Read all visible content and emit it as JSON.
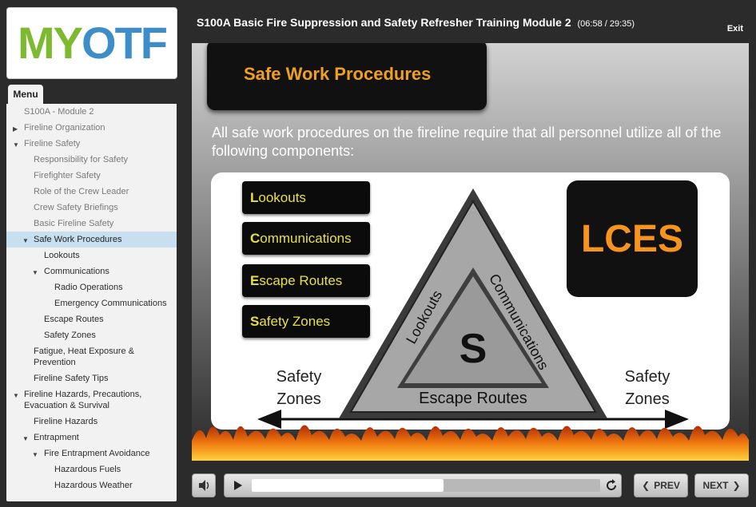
{
  "logo": {
    "text_m": "M",
    "text_y": "Y",
    "text_otf": "OTF"
  },
  "course": {
    "title": "S100A Basic Fire Suppression and Safety Refresher Training Module 2",
    "time": "(06:58 / 29:35)"
  },
  "header": {
    "exit_label": "Exit"
  },
  "menu": {
    "tab_label": "Menu",
    "items": [
      {
        "label": "S100A - Module 2",
        "level": 0,
        "arrow": ""
      },
      {
        "label": "Fireline Organization",
        "level": 0,
        "arrow": "right"
      },
      {
        "label": "Fireline Safety",
        "level": 0,
        "arrow": "down"
      },
      {
        "label": "Responsibility for Safety",
        "level": 1,
        "arrow": ""
      },
      {
        "label": "Firefighter Safety",
        "level": 1,
        "arrow": ""
      },
      {
        "label": "Role of the Crew Leader",
        "level": 1,
        "arrow": ""
      },
      {
        "label": "Crew Safety Briefings",
        "level": 1,
        "arrow": ""
      },
      {
        "label": "Basic Fireline Safety",
        "level": 1,
        "arrow": ""
      },
      {
        "label": "Safe Work Procedures",
        "level": 1,
        "arrow": "down",
        "active": true
      },
      {
        "label": "Lookouts",
        "level": 2,
        "arrow": "",
        "dark": true
      },
      {
        "label": "Communications",
        "level": 2,
        "arrow": "down",
        "dark": true
      },
      {
        "label": "Radio Operations",
        "level": 3,
        "arrow": "",
        "dark": true
      },
      {
        "label": "Emergency Communications",
        "level": 3,
        "arrow": "",
        "dark": true
      },
      {
        "label": "Escape Routes",
        "level": 2,
        "arrow": "",
        "dark": true
      },
      {
        "label": "Safety Zones",
        "level": 2,
        "arrow": "",
        "dark": true
      },
      {
        "label": "Fatigue, Heat Exposure & Prevention",
        "level": 1,
        "arrow": "",
        "dark": true
      },
      {
        "label": "Fireline Safety Tips",
        "level": 1,
        "arrow": "",
        "dark": true
      },
      {
        "label": "Fireline Hazards, Precautions, Evacuation & Survival",
        "level": 0,
        "arrow": "down",
        "dark": true
      },
      {
        "label": "Fireline Hazards",
        "level": 1,
        "arrow": "",
        "dark": true
      },
      {
        "label": "Entrapment",
        "level": 1,
        "arrow": "down",
        "dark": true
      },
      {
        "label": "Fire Entrapment Avoidance",
        "level": 2,
        "arrow": "down",
        "dark": true
      },
      {
        "label": "Hazardous Fuels",
        "level": 3,
        "arrow": "",
        "dark": true
      },
      {
        "label": "Hazardous Weather",
        "level": 3,
        "arrow": "",
        "dark": true
      }
    ]
  },
  "slide": {
    "heading": "Safe Work Procedures",
    "intro": "All safe work procedures on the fireline require that all personnel utilize all of the following components:",
    "components": [
      {
        "first": "L",
        "rest": "ookouts"
      },
      {
        "first": "C",
        "rest": "ommunications"
      },
      {
        "first": "E",
        "rest": "scape Routes"
      },
      {
        "first": "S",
        "rest": "afety Zones"
      }
    ],
    "acronym": "LCES",
    "triangle": {
      "left": "Lookouts",
      "right": "Communications",
      "bottom": "Escape Routes",
      "center": "S"
    },
    "zone_left": [
      "Safety",
      "Zones"
    ],
    "zone_right": [
      "Safety",
      "Zones"
    ]
  },
  "player": {
    "progress": 0.55,
    "prev_label": "PREV",
    "next_label": "NEXT"
  }
}
